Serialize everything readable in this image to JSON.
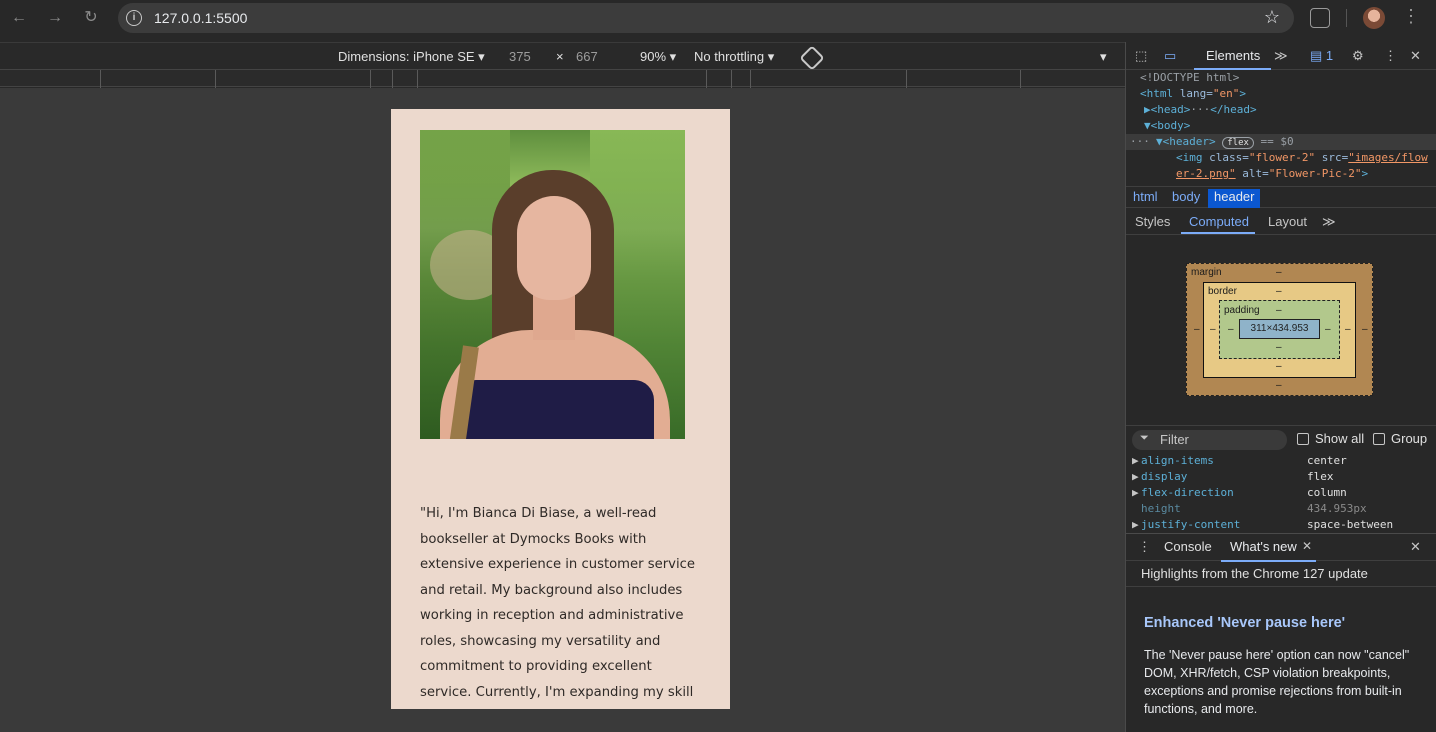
{
  "browser": {
    "url": "127.0.0.1:5500",
    "back_icon": "←",
    "forward_icon": "→",
    "reload_icon": "↻",
    "info_icon": "i",
    "star_icon": "☆",
    "menu_icon": "⋮"
  },
  "device_toolbar": {
    "dimensions_label": "Dimensions: iPhone SE ▾",
    "width": "375",
    "x_sep": "×",
    "height": "667",
    "zoom": "90% ▾",
    "throttling": "No throttling ▾",
    "more_icon": "▾"
  },
  "page": {
    "bio": "\"Hi, I'm Bianca Di Biase, a well-read bookseller at Dymocks Books with extensive experience in customer service and retail. My background also includes working in reception and administrative roles, showcasing my versatility and commitment to providing excellent service. Currently, I'm expanding my skill set by studying coding at"
  },
  "devtools": {
    "tabs": {
      "inspect_icon": "⬚",
      "device_icon": "▭",
      "elements": "Elements",
      "more": "≫",
      "issues_count": "1",
      "settings_icon": "⚙",
      "dots_icon": "⋮",
      "close_icon": "✕"
    },
    "dom": {
      "line1": "<!DOCTYPE html>",
      "line2_tag": "<html ",
      "line2_attr": "lang=",
      "line2_val": "\"en\"",
      "line2_end": ">",
      "line3": "▶<head>",
      "line3_dots": "···",
      "line3_end": "</head>",
      "line4": "▼<body>",
      "line5_dots": "···",
      "line5_tag": "▼<header>",
      "line5_badge": "flex",
      "line5_eq": "== $0",
      "line6_tag": "<img ",
      "line6_attr1": "class=",
      "line6_val1": "\"flower-2\"",
      "line6_attr2": " src=",
      "line6_val2": "\"images/flow",
      "line7_val2": "er-2.png\"",
      "line7_attr3": " alt=",
      "line7_val3": "\"Flower-Pic-2\"",
      "line7_end": ">"
    },
    "breadcrumbs": [
      "html",
      "body",
      "header"
    ],
    "subtabs": {
      "styles": "Styles",
      "computed": "Computed",
      "layout": "Layout",
      "more": "≫"
    },
    "box_model": {
      "margin_label": "margin",
      "border_label": "border",
      "padding_label": "padding",
      "content_size": "311×434.953",
      "dash": "–"
    },
    "filter": {
      "placeholder": "Filter",
      "icon": "⏷",
      "show_all": "Show all",
      "group": "Group"
    },
    "properties": [
      {
        "name": "align-items",
        "value": "center"
      },
      {
        "name": "display",
        "value": "flex"
      },
      {
        "name": "flex-direction",
        "value": "column"
      },
      {
        "name": "height",
        "value": "434.953px"
      },
      {
        "name": "justify-content",
        "value": "space-between"
      }
    ],
    "drawer": {
      "menu_icon": "⋮",
      "console": "Console",
      "whats_new": "What's new",
      "tab_close": "✕",
      "close": "✕"
    },
    "whats_new": {
      "heading": "Highlights from the Chrome 127 update",
      "title": "Enhanced 'Never pause here'",
      "body": "The 'Never pause here' option can now \"cancel\" DOM, XHR/fetch, CSP violation breakpoints, exceptions and promise rejections from built-in functions, and more."
    }
  }
}
